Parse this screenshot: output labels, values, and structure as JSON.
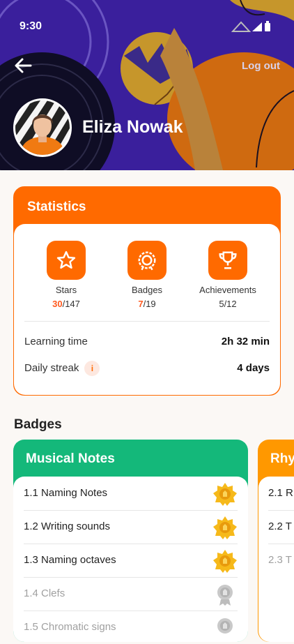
{
  "status_bar": {
    "time": "9:30"
  },
  "header": {
    "logout_label": "Log out",
    "user_name": "Eliza Nowak"
  },
  "statistics": {
    "title": "Statistics",
    "items": [
      {
        "label": "Stars",
        "current": "30",
        "total": "/147",
        "icon": "star-icon"
      },
      {
        "label": "Badges",
        "current": "7",
        "total": "/19",
        "icon": "badge-icon"
      },
      {
        "label": "Achievements",
        "value": "5/12",
        "icon": "trophy-icon"
      }
    ],
    "learning_time_label": "Learning time",
    "learning_time_value": "2h 32 min",
    "daily_streak_label": "Daily streak",
    "daily_streak_value": "4 days",
    "info_glyph": "i"
  },
  "badges_section": {
    "title": "Badges",
    "cards": [
      {
        "title": "Musical Notes",
        "color": "#14b87a",
        "items": [
          {
            "label": "1.1 Naming Notes",
            "medal": "gold"
          },
          {
            "label": "1.2 Writing sounds",
            "medal": "gold"
          },
          {
            "label": "1.3 Naming octaves",
            "medal": "gold"
          },
          {
            "label": "1.4 Clefs",
            "medal": "silver"
          },
          {
            "label": "1.5 Chromatic signs",
            "medal": "silver"
          }
        ]
      },
      {
        "title": "Rhy",
        "color": "#ff9800",
        "items": [
          {
            "label": "2.1 R"
          },
          {
            "label": "2.2 T"
          },
          {
            "label": "2.3 T"
          }
        ]
      }
    ]
  },
  "colors": {
    "accent_orange": "#ff6a00",
    "header_purple": "#3a1f9c",
    "green": "#14b87a"
  }
}
